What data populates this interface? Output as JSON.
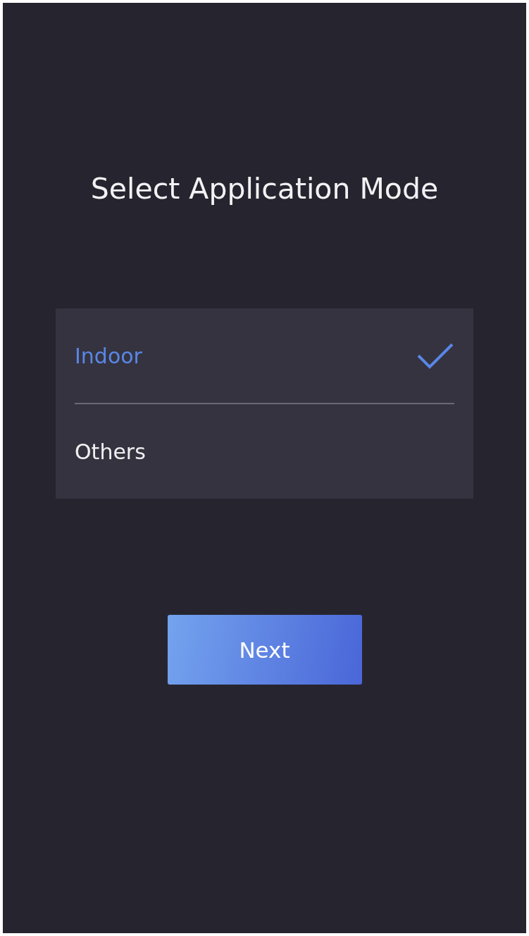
{
  "title": "Select Application Mode",
  "options": [
    {
      "label": "Indoor",
      "selected": true
    },
    {
      "label": "Others",
      "selected": false
    }
  ],
  "next_button": "Next"
}
